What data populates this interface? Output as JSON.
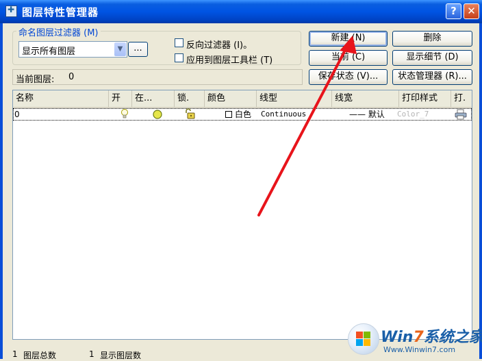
{
  "window": {
    "title": "图层特性管理器",
    "help_glyph": "?",
    "close_glyph": "✕"
  },
  "filter": {
    "group_label": "命名图层过滤器 (M)",
    "combo_value": "显示所有图层",
    "browse_label": "...",
    "invert_label": "反向过滤器 (I)。",
    "apply_toolbar_label": "应用到图层工具栏 (T)"
  },
  "current_layer": {
    "label": "当前图层:",
    "value": "0"
  },
  "buttons": {
    "new": "新建 (N)",
    "delete": "删除",
    "current": "当前 (C)",
    "show_details": "显示细节 (D)",
    "save_state": "保存状态 (V)...",
    "state_manager": "状态管理器 (R)..."
  },
  "table": {
    "columns": [
      "名称",
      "开",
      "在...",
      "锁.",
      "颜色",
      "线型",
      "线宽",
      "打印样式",
      "打."
    ],
    "rows": [
      {
        "name": "0",
        "color": "白色",
        "linetype": "Continuous",
        "lineweight": "—— 默认",
        "plot_style": "Color_7"
      }
    ]
  },
  "status": {
    "total_count": "1",
    "total_label": "图层总数",
    "shown_count": "1",
    "shown_label": "显示图层数"
  },
  "watermark": {
    "brand_a": "Win",
    "brand_b": "7",
    "brand_c": "系统之家",
    "url": "Www.Winwin7.com"
  },
  "colors": {
    "titlebar": "#0054e3",
    "arrow": "#e8141b",
    "accent_label": "#0046d5"
  }
}
